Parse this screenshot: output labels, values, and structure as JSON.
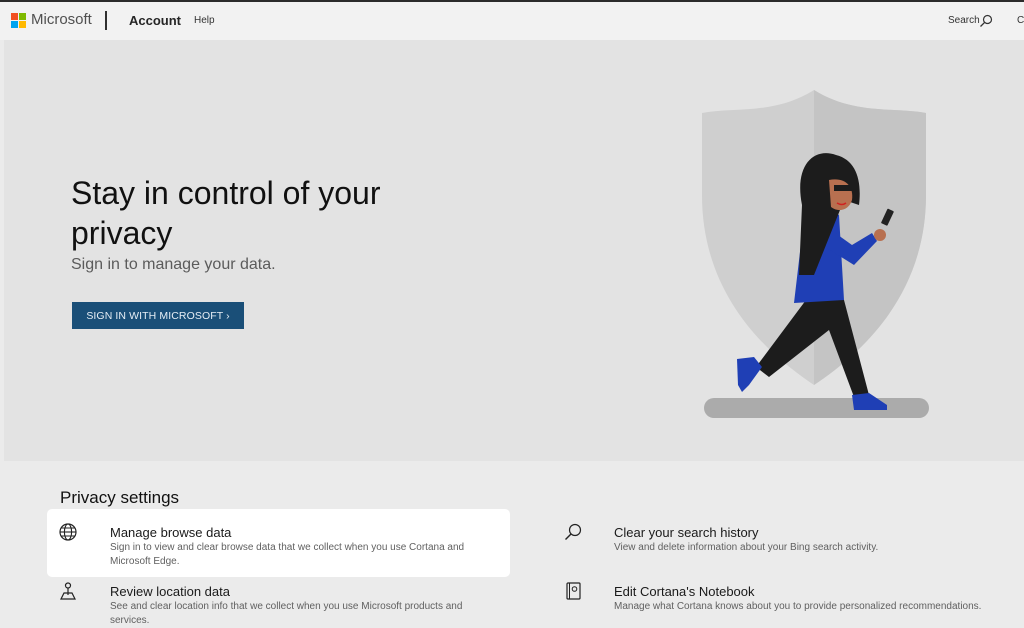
{
  "header": {
    "brand": "Microsoft",
    "nav": {
      "account": "Account",
      "help": "Help"
    },
    "search_label": "Search",
    "overflow_label": "C",
    "logo_colors": [
      "#f25022",
      "#7fba00",
      "#00a4ef",
      "#ffb900"
    ]
  },
  "hero": {
    "title": "Stay in control of your privacy",
    "subtitle": "Sign in to manage your data.",
    "signin_button": "SIGN IN WITH MICROSOFT ›"
  },
  "privacy": {
    "section_title": "Privacy settings",
    "items": [
      {
        "icon": "globe-icon",
        "title": "Manage browse data",
        "description": "Sign in to view and clear browse data that we collect when you use Cortana and Microsoft Edge."
      },
      {
        "icon": "search-icon",
        "title": "Clear your search history",
        "description": "View and delete information about your Bing search activity."
      },
      {
        "icon": "location-icon",
        "title": "Review location data",
        "description": "See and clear location info that we collect when you use Microsoft products and services."
      },
      {
        "icon": "notebook-icon",
        "title": "Edit Cortana's Notebook",
        "description": "Manage what Cortana knows about you to provide personalized recommendations."
      }
    ]
  },
  "colors": {
    "accent": "#1a4f78",
    "figure_blue": "#1f3fb5"
  }
}
